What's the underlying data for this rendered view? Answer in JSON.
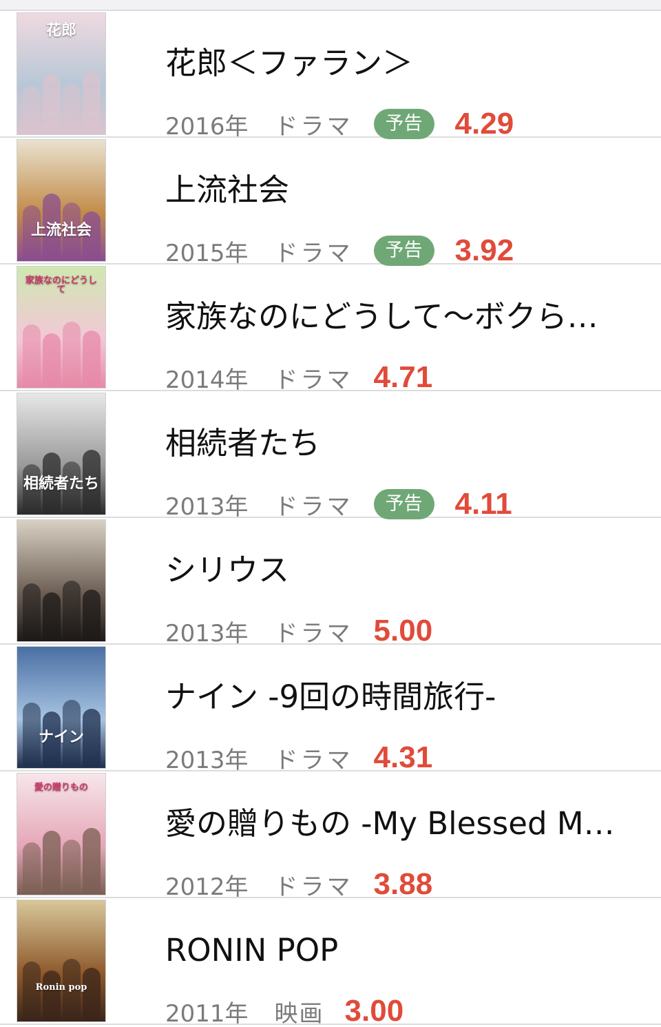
{
  "items": [
    {
      "title": "花郎＜ファラン＞",
      "year": "2016年",
      "genre": "ドラマ",
      "badge": "予告",
      "rating": "4.29",
      "poster_text": "花郎",
      "poster_colors": [
        "#efd9e0",
        "#b7c7d6",
        "#d9c3ce"
      ]
    },
    {
      "title": "上流社会",
      "year": "2015年",
      "genre": "ドラマ",
      "badge": "予告",
      "rating": "3.92",
      "poster_text": "上流社会",
      "poster_colors": [
        "#e9e2cf",
        "#c28c4a",
        "#8a4d8f"
      ]
    },
    {
      "title": "家族なのにどうして〜ボクら…",
      "year": "2014年",
      "genre": "ドラマ",
      "badge": "",
      "rating": "4.71",
      "poster_text": "家族なのにどうして",
      "poster_colors": [
        "#cfe8b0",
        "#f3c7d8",
        "#e68aa8"
      ]
    },
    {
      "title": "相続者たち",
      "year": "2013年",
      "genre": "ドラマ",
      "badge": "予告",
      "rating": "4.11",
      "poster_text": "相続者たち",
      "poster_colors": [
        "#e7e7e7",
        "#9a9a9a",
        "#2b2b2b"
      ]
    },
    {
      "title": "シリウス",
      "year": "2013年",
      "genre": "ドラマ",
      "badge": "",
      "rating": "5.00",
      "poster_text": "",
      "poster_colors": [
        "#d9d1c4",
        "#6d5f55",
        "#1d1a18"
      ]
    },
    {
      "title": "ナイン -9回の時間旅行-",
      "year": "2013年",
      "genre": "ドラマ",
      "badge": "",
      "rating": "4.31",
      "poster_text": "ナイン",
      "poster_colors": [
        "#4a6fa3",
        "#a8c4e2",
        "#1f2f4d"
      ]
    },
    {
      "title": "愛の贈りもの -My Blessed M…",
      "year": "2012年",
      "genre": "ドラマ",
      "badge": "",
      "rating": "3.88",
      "poster_text": "愛の贈りもの",
      "poster_colors": [
        "#f7e6ea",
        "#e5a7b8",
        "#7a5e53"
      ]
    },
    {
      "title": "RONIN POP",
      "year": "2011年",
      "genre": "映画",
      "badge": "",
      "rating": "3.00",
      "poster_text": "Ronin pop",
      "poster_colors": [
        "#d8c79a",
        "#8e5a2c",
        "#3b261a"
      ]
    }
  ]
}
